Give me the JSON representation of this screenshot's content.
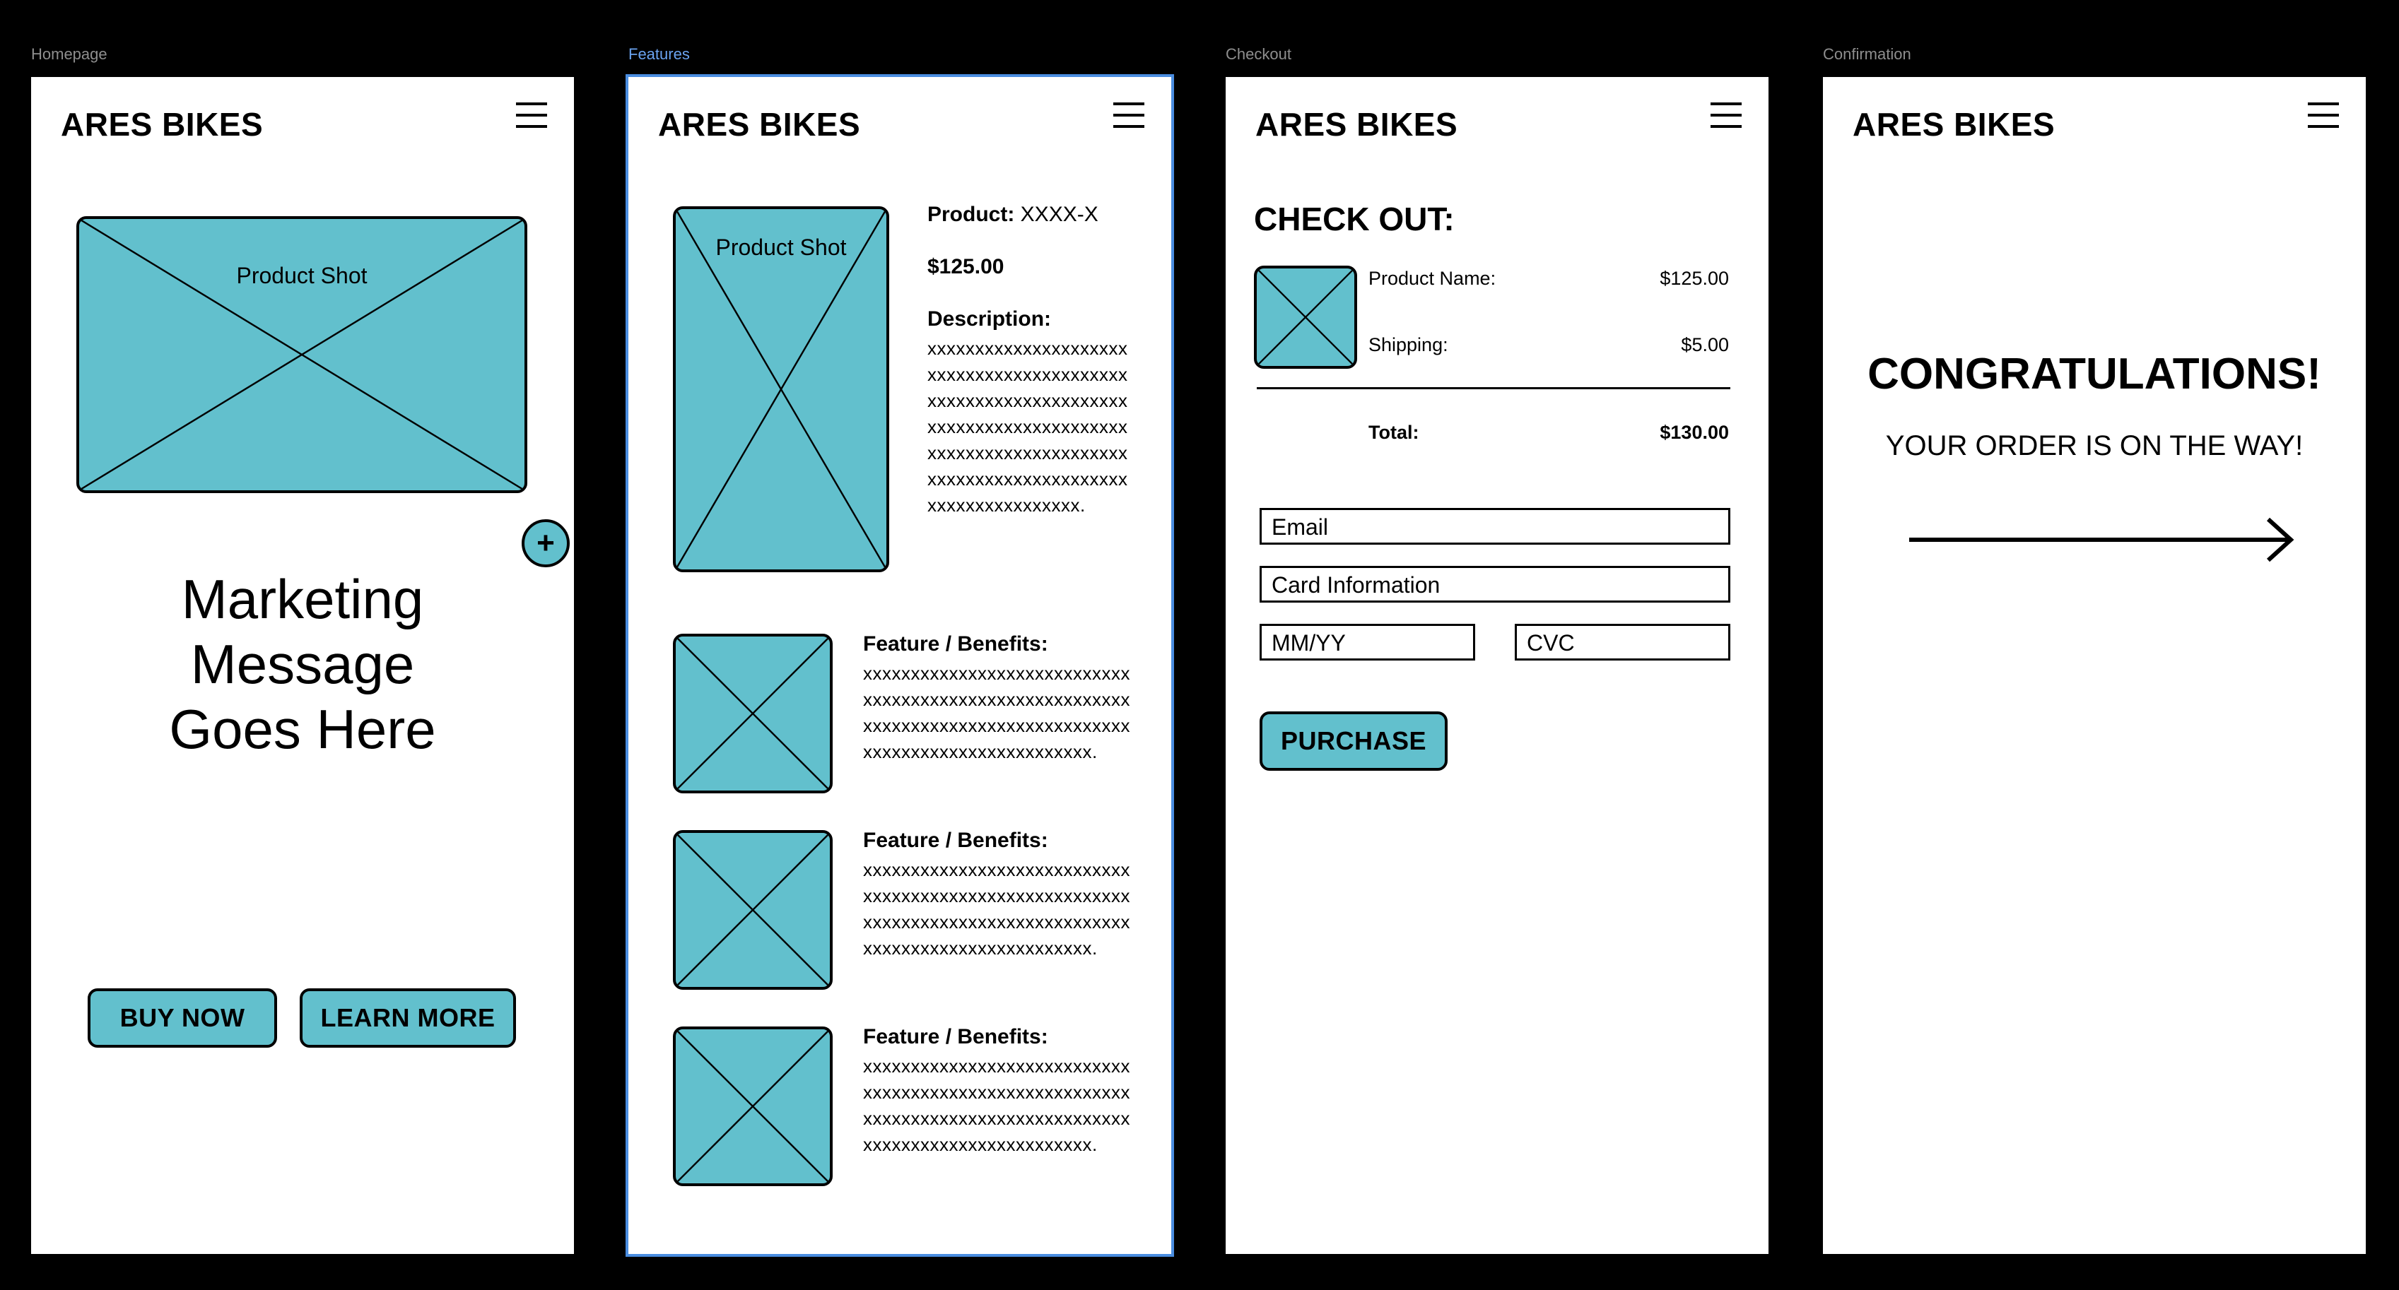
{
  "frames": {
    "homepage": {
      "label": "Homepage",
      "brand": "ARES BIKES",
      "product_shot_label": "Product Shot",
      "add_symbol": "+",
      "marketing": [
        "Marketing",
        "Message",
        "Goes Here"
      ],
      "buy_now": "BUY NOW",
      "learn_more": "LEARN MORE"
    },
    "features": {
      "label": "Features",
      "brand": "ARES BIKES",
      "product_shot_label": "Product Shot",
      "product_label": "Product:",
      "product_value": "XXXX-X",
      "price": "$125.00",
      "description_label": "Description:",
      "description_text": "xxxxxxxxxxxxxxxxxxxxxxxxxxxxxxxxxxxxxxxxxxxxxxxxxxxxxxxxxxxxxxxxxxxxxxxxxxxxxxxxxxxxxxxxxxxxxxxxxxxxxxxxxxxxxxxxxxxxxxxxxxxxxxxxxxxxxxxxxxxxxx.",
      "feature_label": "Feature / Benefits:",
      "feature_text": "xxxxxxxxxxxxxxxxxxxxxxxxxxxxxxxxxxxxxxxxxxxxxxxxxxxxxxxxxxxxxxxxxxxxxxxxxxxxxxxxxxxxxxxxxxxxxxxxxxxxxxxxxxxx."
    },
    "checkout": {
      "label": "Checkout",
      "brand": "ARES BIKES",
      "title": "CHECK OUT:",
      "product_name_label": "Product Name:",
      "product_name_value": "$125.00",
      "shipping_label": "Shipping:",
      "shipping_value": "$5.00",
      "total_label": "Total:",
      "total_value": "$130.00",
      "email_placeholder": "Email",
      "card_placeholder": "Card Information",
      "mmyy_placeholder": "MM/YY",
      "cvc_placeholder": "CVC",
      "purchase": "PURCHASE"
    },
    "confirmation": {
      "label": "Confirmation",
      "brand": "ARES BIKES",
      "headline": "CONGRATULATIONS!",
      "subline": "YOUR ORDER IS ON THE WAY!"
    }
  },
  "colors": {
    "background": "#000000",
    "frame": "#ffffff",
    "accent": "#62c0cd",
    "selection": "#4a8de0"
  },
  "icons": [
    "menu-icon",
    "plus-icon",
    "arrow-right-icon",
    "image-placeholder-icon"
  ]
}
